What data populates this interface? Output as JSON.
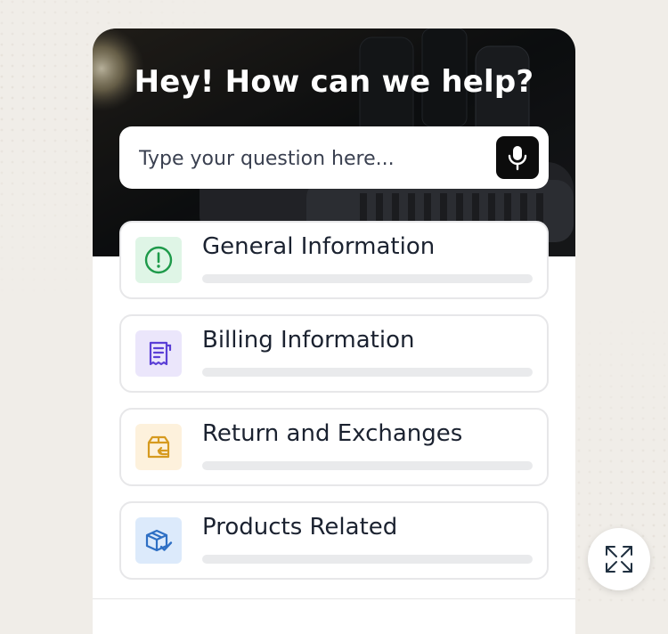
{
  "header": {
    "title": "Hey! How can we help?"
  },
  "search": {
    "placeholder": "Type your question here...",
    "mic_icon": "microphone-icon"
  },
  "categories": [
    {
      "label": "General Information",
      "icon": "info-circle-icon",
      "color": "#1e9a4a",
      "bg": "#dff5e6"
    },
    {
      "label": "Billing Information",
      "icon": "receipt-icon",
      "color": "#5b3fd6",
      "bg": "#ebe6fb"
    },
    {
      "label": "Return and Exchanges",
      "icon": "box-return-icon",
      "color": "#d69a1f",
      "bg": "#fdf1dc"
    },
    {
      "label": "Products Related",
      "icon": "package-check-icon",
      "color": "#2e6fc4",
      "bg": "#dceafb"
    }
  ],
  "expand": {
    "icon": "expand-icon"
  }
}
